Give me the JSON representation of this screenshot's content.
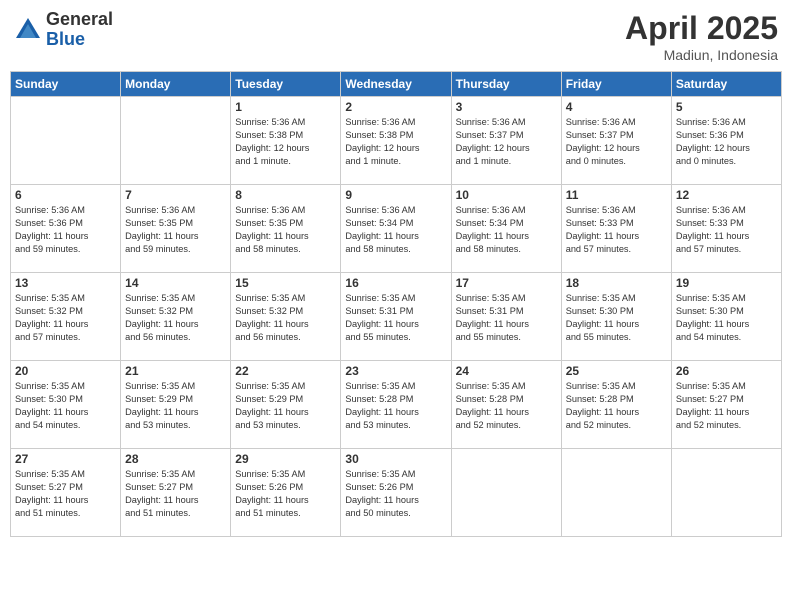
{
  "header": {
    "logo_general": "General",
    "logo_blue": "Blue",
    "month": "April 2025",
    "location": "Madiun, Indonesia"
  },
  "days_of_week": [
    "Sunday",
    "Monday",
    "Tuesday",
    "Wednesday",
    "Thursday",
    "Friday",
    "Saturday"
  ],
  "weeks": [
    [
      {
        "day": "",
        "info": ""
      },
      {
        "day": "",
        "info": ""
      },
      {
        "day": "1",
        "info": "Sunrise: 5:36 AM\nSunset: 5:38 PM\nDaylight: 12 hours\nand 1 minute."
      },
      {
        "day": "2",
        "info": "Sunrise: 5:36 AM\nSunset: 5:38 PM\nDaylight: 12 hours\nand 1 minute."
      },
      {
        "day": "3",
        "info": "Sunrise: 5:36 AM\nSunset: 5:37 PM\nDaylight: 12 hours\nand 1 minute."
      },
      {
        "day": "4",
        "info": "Sunrise: 5:36 AM\nSunset: 5:37 PM\nDaylight: 12 hours\nand 0 minutes."
      },
      {
        "day": "5",
        "info": "Sunrise: 5:36 AM\nSunset: 5:36 PM\nDaylight: 12 hours\nand 0 minutes."
      }
    ],
    [
      {
        "day": "6",
        "info": "Sunrise: 5:36 AM\nSunset: 5:36 PM\nDaylight: 11 hours\nand 59 minutes."
      },
      {
        "day": "7",
        "info": "Sunrise: 5:36 AM\nSunset: 5:35 PM\nDaylight: 11 hours\nand 59 minutes."
      },
      {
        "day": "8",
        "info": "Sunrise: 5:36 AM\nSunset: 5:35 PM\nDaylight: 11 hours\nand 58 minutes."
      },
      {
        "day": "9",
        "info": "Sunrise: 5:36 AM\nSunset: 5:34 PM\nDaylight: 11 hours\nand 58 minutes."
      },
      {
        "day": "10",
        "info": "Sunrise: 5:36 AM\nSunset: 5:34 PM\nDaylight: 11 hours\nand 58 minutes."
      },
      {
        "day": "11",
        "info": "Sunrise: 5:36 AM\nSunset: 5:33 PM\nDaylight: 11 hours\nand 57 minutes."
      },
      {
        "day": "12",
        "info": "Sunrise: 5:36 AM\nSunset: 5:33 PM\nDaylight: 11 hours\nand 57 minutes."
      }
    ],
    [
      {
        "day": "13",
        "info": "Sunrise: 5:35 AM\nSunset: 5:32 PM\nDaylight: 11 hours\nand 57 minutes."
      },
      {
        "day": "14",
        "info": "Sunrise: 5:35 AM\nSunset: 5:32 PM\nDaylight: 11 hours\nand 56 minutes."
      },
      {
        "day": "15",
        "info": "Sunrise: 5:35 AM\nSunset: 5:32 PM\nDaylight: 11 hours\nand 56 minutes."
      },
      {
        "day": "16",
        "info": "Sunrise: 5:35 AM\nSunset: 5:31 PM\nDaylight: 11 hours\nand 55 minutes."
      },
      {
        "day": "17",
        "info": "Sunrise: 5:35 AM\nSunset: 5:31 PM\nDaylight: 11 hours\nand 55 minutes."
      },
      {
        "day": "18",
        "info": "Sunrise: 5:35 AM\nSunset: 5:30 PM\nDaylight: 11 hours\nand 55 minutes."
      },
      {
        "day": "19",
        "info": "Sunrise: 5:35 AM\nSunset: 5:30 PM\nDaylight: 11 hours\nand 54 minutes."
      }
    ],
    [
      {
        "day": "20",
        "info": "Sunrise: 5:35 AM\nSunset: 5:30 PM\nDaylight: 11 hours\nand 54 minutes."
      },
      {
        "day": "21",
        "info": "Sunrise: 5:35 AM\nSunset: 5:29 PM\nDaylight: 11 hours\nand 53 minutes."
      },
      {
        "day": "22",
        "info": "Sunrise: 5:35 AM\nSunset: 5:29 PM\nDaylight: 11 hours\nand 53 minutes."
      },
      {
        "day": "23",
        "info": "Sunrise: 5:35 AM\nSunset: 5:28 PM\nDaylight: 11 hours\nand 53 minutes."
      },
      {
        "day": "24",
        "info": "Sunrise: 5:35 AM\nSunset: 5:28 PM\nDaylight: 11 hours\nand 52 minutes."
      },
      {
        "day": "25",
        "info": "Sunrise: 5:35 AM\nSunset: 5:28 PM\nDaylight: 11 hours\nand 52 minutes."
      },
      {
        "day": "26",
        "info": "Sunrise: 5:35 AM\nSunset: 5:27 PM\nDaylight: 11 hours\nand 52 minutes."
      }
    ],
    [
      {
        "day": "27",
        "info": "Sunrise: 5:35 AM\nSunset: 5:27 PM\nDaylight: 11 hours\nand 51 minutes."
      },
      {
        "day": "28",
        "info": "Sunrise: 5:35 AM\nSunset: 5:27 PM\nDaylight: 11 hours\nand 51 minutes."
      },
      {
        "day": "29",
        "info": "Sunrise: 5:35 AM\nSunset: 5:26 PM\nDaylight: 11 hours\nand 51 minutes."
      },
      {
        "day": "30",
        "info": "Sunrise: 5:35 AM\nSunset: 5:26 PM\nDaylight: 11 hours\nand 50 minutes."
      },
      {
        "day": "",
        "info": ""
      },
      {
        "day": "",
        "info": ""
      },
      {
        "day": "",
        "info": ""
      }
    ]
  ]
}
